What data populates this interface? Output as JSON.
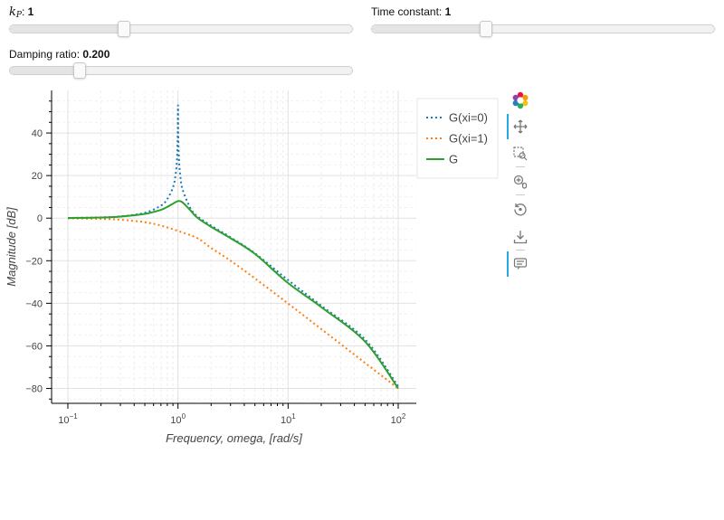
{
  "sliders": {
    "kp": {
      "title_main": "k",
      "title_sub": "P",
      "title_suffix": ": ",
      "value": "1",
      "fraction": 0.33
    },
    "time_constant": {
      "title": "Time constant: ",
      "value": "1",
      "fraction": 0.33
    },
    "damping": {
      "title": "Damping ratio: ",
      "value": "0.200",
      "fraction": 0.2
    }
  },
  "toolbar": {
    "tools": [
      "bokeh-logo-icon",
      "pan-icon",
      "box-zoom-icon",
      "wheel-zoom-icon",
      "reset-icon",
      "save-icon",
      "hover-icon"
    ]
  },
  "chart_data": {
    "type": "line",
    "title": "",
    "xlabel": "Frequency, omega, [rad/s]",
    "ylabel": "Magnitude [dB]",
    "x_scale": "log",
    "xlim": [
      0.1,
      100
    ],
    "ylim": [
      -87,
      60
    ],
    "x_tick_labels": [
      "10^-1",
      "10^0",
      "10^1",
      "10^2"
    ],
    "y_ticks": [
      40,
      20,
      0,
      -20,
      -40,
      -60,
      -80
    ],
    "grid": true,
    "legend_position": "top-right",
    "series": [
      {
        "name": "G(xi=0)",
        "color": "#1f77b4",
        "dash": "dotted",
        "x": [
          0.1,
          0.2,
          0.3,
          0.5,
          0.7,
          0.8,
          0.9,
          0.95,
          0.98,
          0.995,
          1.0,
          1.005,
          1.02,
          1.05,
          1.1,
          1.3,
          1.5,
          2,
          3,
          5,
          10,
          20,
          50,
          100
        ],
        "y": [
          0.09,
          0.35,
          0.82,
          2.5,
          5.9,
          9.0,
          14.4,
          20.2,
          28.0,
          40.0,
          53.0,
          40.0,
          28.0,
          20.0,
          13.5,
          4.6,
          0.9,
          -3.5,
          -9.0,
          -16.5,
          -29.1,
          -41.1,
          -57.0,
          -79.0
        ]
      },
      {
        "name": "G(xi=1)",
        "color": "#ff7f0e",
        "dash": "dotted",
        "x": [
          0.1,
          0.2,
          0.3,
          0.5,
          0.7,
          1.0,
          1.5,
          2,
          3,
          5,
          10,
          20,
          50,
          100
        ],
        "y": [
          -0.09,
          -0.34,
          -0.75,
          -1.9,
          -3.5,
          -6.0,
          -9.4,
          -14.0,
          -20.0,
          -28.3,
          -40.1,
          -52.1,
          -68.0,
          -80.0
        ]
      },
      {
        "name": "G",
        "color": "#2ca02c",
        "dash": "solid",
        "x": [
          0.1,
          0.2,
          0.3,
          0.5,
          0.7,
          0.8,
          0.9,
          1.0,
          1.1,
          1.3,
          1.5,
          2,
          3,
          5,
          10,
          20,
          50,
          100
        ],
        "y": [
          0.07,
          0.29,
          0.71,
          2.0,
          3.9,
          5.3,
          6.8,
          8.0,
          7.4,
          3.6,
          0.2,
          -4.1,
          -9.4,
          -16.8,
          -30.5,
          -41.8,
          -58.0,
          -80.0
        ]
      }
    ]
  }
}
